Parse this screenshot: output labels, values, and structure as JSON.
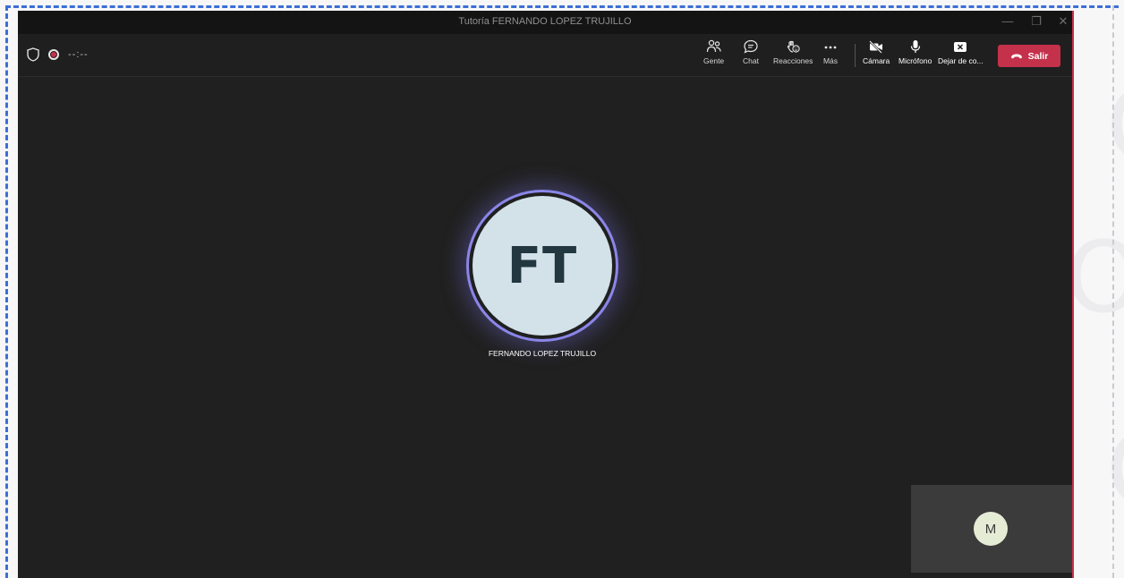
{
  "window": {
    "title": "Tutoría FERNANDO LOPEZ TRUJILLO",
    "controls": {
      "minimize": "—",
      "maximize": "❐",
      "close": "✕"
    }
  },
  "toolbar": {
    "timer": "--:--",
    "buttons": {
      "people": "Gente",
      "chat": "Chat",
      "reactions": "Reacciones",
      "more": "Más",
      "camera": "Cámara",
      "mic": "Micrófono",
      "share": "Dejar de co..."
    },
    "leave": "Salir"
  },
  "stage": {
    "participant_initials": "FT",
    "participant_name": "FERNANDO LOPEZ TRUJILLO",
    "self_initial": "M"
  },
  "colors": {
    "leave_red": "#c4314b",
    "speaker_ring": "#8b86e8",
    "selection_dash": "#3d6fd6"
  },
  "icons": [
    "shield-icon",
    "recording-dot-icon",
    "people-icon",
    "chat-icon",
    "reactions-icon",
    "more-icon",
    "camera-off-icon",
    "mic-icon",
    "stop-share-icon",
    "phone-hangup-icon"
  ]
}
